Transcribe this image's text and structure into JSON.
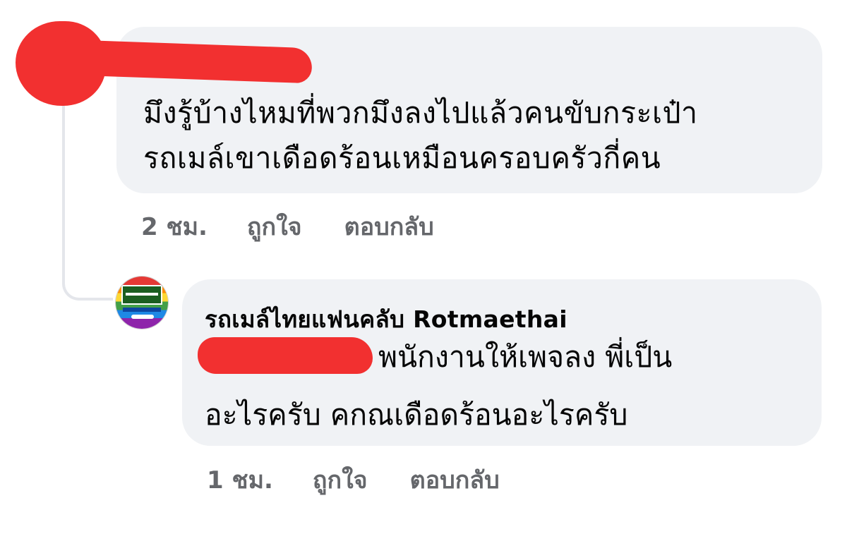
{
  "comments": [
    {
      "text_lines": [
        "มึงรู้บ้างไหมที่พวกมึงลงไปแล้วคนขับกระเป๋า",
        "รถเมล์เขาเดือดร้อนเหมือนครอบครัวกี่คน"
      ],
      "timestamp": "2 ชม.",
      "like_label": "ถูกใจ",
      "reply_label": "ตอบกลับ"
    },
    {
      "author": "รถเมล์ไทยแฟนคลับ Rotmaethai",
      "text_lines": [
        "พนักงานให้เพจลง พี่เป็น",
        "อะไรครับ คกณเดือดร้อนอะไรครับ"
      ],
      "timestamp": "1 ชม.",
      "like_label": "ถูกใจ",
      "reply_label": "ตอบกลับ"
    }
  ],
  "colors": {
    "bubble": "#f0f2f5",
    "redaction": "#f23030",
    "meta_text": "#65676b",
    "thread_line": "#e4e6eb"
  }
}
